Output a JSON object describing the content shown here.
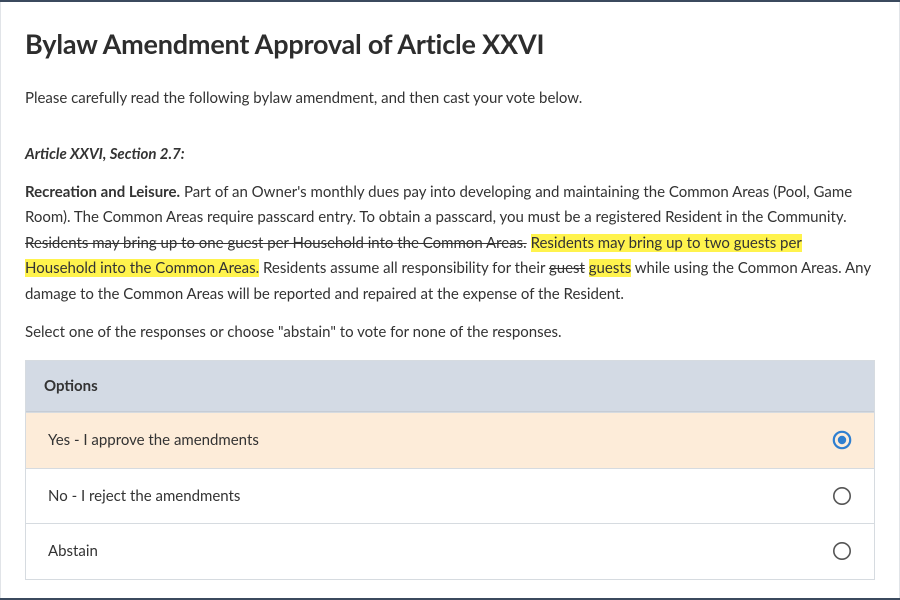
{
  "title": "Bylaw Amendment Approval of Article XXVI",
  "intro": "Please carefully read the following bylaw amendment, and then cast your vote below.",
  "section_heading": "Article XXVI, Section 2.7:",
  "bylaw": {
    "topic": "Recreation and Leisure.",
    "body_1": " Part of an Owner's monthly dues pay into developing and maintaining the Common Areas (Pool, Game Room). The Common Areas require passcard entry. To obtain a passcard, you must be a registered Resident in the Community. ",
    "strike_1": "Residents may bring up to one guest per Household into the Common Areas.",
    "add_1": "Residents may bring up to two guests per Household into the Common Areas.",
    "body_2": " Residents assume all responsibility for their ",
    "strike_2": "guest",
    "add_2": "guests",
    "body_3": " while using the Common Areas. Any damage to the Common Areas will be reported and repaired at the expense of the Resident."
  },
  "select_instruction": "Select one of the responses or choose \"abstain\" to vote for none of the responses.",
  "options_header": "Options",
  "options": [
    {
      "label": "Yes - I approve the amendments",
      "selected": true
    },
    {
      "label": "No - I reject the amendments",
      "selected": false
    },
    {
      "label": "Abstain",
      "selected": false
    }
  ],
  "colors": {
    "accent": "#2f7fd0",
    "selected_bg": "#fdecd9",
    "header_bg": "#d3dae4",
    "highlight": "#fff34d"
  }
}
